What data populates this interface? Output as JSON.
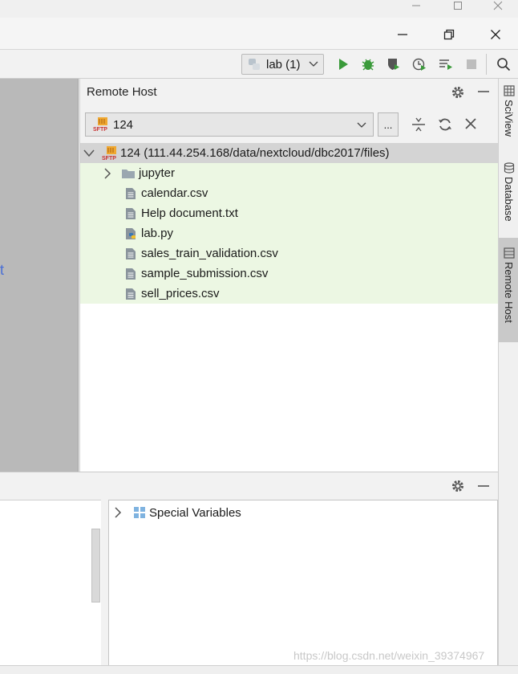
{
  "toolbar": {
    "run_config": "lab (1)"
  },
  "left_pane": {
    "partial_text": "t"
  },
  "remote_host": {
    "title": "Remote Host",
    "selected_host": "124",
    "more_label": "...",
    "tree": {
      "root": "124 (111.44.254.168/data/nextcloud/dbc2017/files)",
      "items": [
        {
          "label": "jupyter",
          "icon": "folder-icon"
        },
        {
          "label": "calendar.csv",
          "icon": "text-file-icon"
        },
        {
          "label": "Help document.txt",
          "icon": "text-file-icon"
        },
        {
          "label": "lab.py",
          "icon": "python-file-icon"
        },
        {
          "label": "sales_train_validation.csv",
          "icon": "text-file-icon"
        },
        {
          "label": "sample_submission.csv",
          "icon": "text-file-icon"
        },
        {
          "label": "sell_prices.csv",
          "icon": "text-file-icon"
        }
      ]
    }
  },
  "right_sidebar": {
    "tabs": [
      "SciView",
      "Database",
      "Remote Host"
    ]
  },
  "variables": {
    "special_label": "Special Variables"
  },
  "watermark": "https://blog.csdn.net/weixin_39374967",
  "colors": {
    "tree_bg": "#ecf7e3",
    "run_green": "#3a9a3a",
    "link_blue": "#4a6fd6"
  }
}
